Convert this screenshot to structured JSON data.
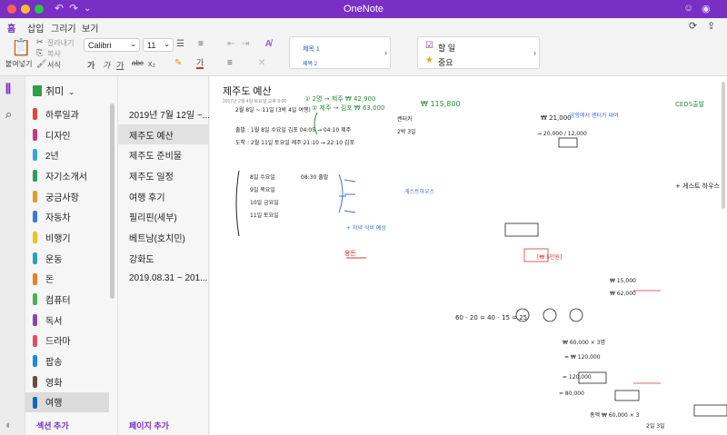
{
  "window": {
    "title": "OneNote"
  },
  "menu": {
    "tabs": [
      "홈",
      "삽입",
      "그리기",
      "보기"
    ]
  },
  "ribbon": {
    "paste": "붙여넣기",
    "cut": "잘라내기",
    "copy": "복사",
    "format": "서식",
    "font": "Calibri",
    "size": "11",
    "styles": [
      "제목 1",
      "제목 2"
    ],
    "tags": [
      "할 일",
      "중요"
    ]
  },
  "notebook": {
    "name": "취미"
  },
  "sections": [
    {
      "label": "하루일과",
      "color": "#e0473d"
    },
    {
      "label": "디자인",
      "color": "#c93a7a"
    },
    {
      "label": "2년",
      "color": "#3aa5d9"
    },
    {
      "label": "자기소개서",
      "color": "#2e9e5b"
    },
    {
      "label": "궁금사항",
      "color": "#e69b2c"
    },
    {
      "label": "자동차",
      "color": "#3b7bd1"
    },
    {
      "label": "비행기",
      "color": "#f0c020"
    },
    {
      "label": "운동",
      "color": "#2ba3b5"
    },
    {
      "label": "돈",
      "color": "#f07d2a"
    },
    {
      "label": "컴퓨터",
      "color": "#4caf50"
    },
    {
      "label": "독서",
      "color": "#8e44ad"
    },
    {
      "label": "드라마",
      "color": "#e04f5f"
    },
    {
      "label": "팝송",
      "color": "#1e88e5"
    },
    {
      "label": "영화",
      "color": "#6d4c41"
    },
    {
      "label": "여행",
      "color": "#1565c0"
    }
  ],
  "selected_section": "여행",
  "add_section": "섹션 추가",
  "pages": [
    "2019년 7월 12일 ~...",
    "제주도 예산",
    "제주도 준비물",
    "제주도 일정",
    "여행 후기",
    "필리핀(세부)",
    "베트남(호치민)",
    "강화도",
    "2019.08.31 ~ 201..."
  ],
  "selected_page": "제주도 예산",
  "add_page": "페이지 추가",
  "canvas": {
    "title": "제주도 예산",
    "meta": "2017년 2월 4일 토요일        오후 9:00",
    "ink": [
      {
        "text": "① 2명 → 제주  ₩ 42,900",
        "color": "green"
      },
      {
        "text": "2월 8일 ~ 11일 (3박 4일 여행)",
        "color": "dark"
      },
      {
        "text": "② 제주 → 김포  ₩ 63,000",
        "color": "green"
      },
      {
        "text": "₩ 115,800",
        "color": "green"
      },
      {
        "text": "출발 : 1월 8일 수요일  김포 04:05 → 04:10 제주",
        "color": "dark"
      },
      {
        "text": "도착 : 2월 11일 토요일  제주 21:10 → 22:10 김포",
        "color": "dark"
      },
      {
        "text": "렌터카",
        "color": "dark"
      },
      {
        "text": "2박 3일",
        "color": "dark"
      },
      {
        "text": "₩ 21,000",
        "color": "dark"
      },
      {
        "text": "→ 20,000 / 12,000",
        "color": "dark"
      },
      {
        "text": "공항에서 렌터카 대여",
        "color": "blue"
      },
      {
        "text": "CEDS출발",
        "color": "green"
      },
      {
        "text": "+ 게스트 하우스",
        "color": "dark"
      },
      {
        "text": "8일 수요일",
        "color": "dark"
      },
      {
        "text": "9일 목요일",
        "color": "dark"
      },
      {
        "text": "10일 금요일",
        "color": "dark"
      },
      {
        "text": "11일 토요일",
        "color": "dark"
      },
      {
        "text": "08:30 출발",
        "color": "dark"
      },
      {
        "text": "게스트하우스",
        "color": "blue"
      },
      {
        "text": "+ 저녁 식비 예상",
        "color": "blue"
      },
      {
        "text": "용돈",
        "color": "red"
      },
      {
        "text": "[₩ 5만원]",
        "color": "red"
      },
      {
        "text": "₩ 15,000",
        "color": "dark"
      },
      {
        "text": "₩ 62,000",
        "color": "dark"
      },
      {
        "text": "60 - 20 = 40 - 15 = 25",
        "color": "dark"
      },
      {
        "text": "₩ 60,000 × 3명",
        "color": "dark"
      },
      {
        "text": "= ₩ 120,000",
        "color": "dark"
      },
      {
        "text": "= 120,000",
        "color": "dark"
      },
      {
        "text": "= 80,000",
        "color": "dark"
      },
      {
        "text": "총액 ₩ 60,000 × 3",
        "color": "dark"
      },
      {
        "text": "2일  3일",
        "color": "dark"
      }
    ]
  }
}
